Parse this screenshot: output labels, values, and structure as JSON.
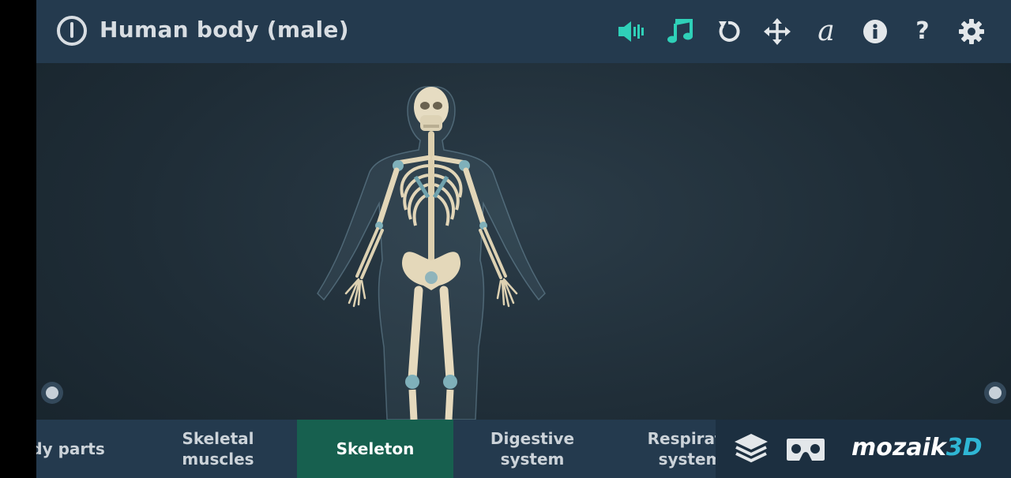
{
  "header": {
    "title": "Human body (male)"
  },
  "toolbar": {
    "icons": [
      "speaker-icon",
      "music-note-icon",
      "reset-rotation-icon",
      "move-icon",
      "text-label-icon",
      "info-icon",
      "help-icon",
      "settings-gear-icon"
    ]
  },
  "tabs": [
    {
      "label": "dy parts",
      "active": false
    },
    {
      "label": "Skeletal\nmuscles",
      "active": false
    },
    {
      "label": "Skeleton",
      "active": true
    },
    {
      "label": "Digestive\nsystem",
      "active": false
    },
    {
      "label": "Respirato\nsystem",
      "active": false
    }
  ],
  "logo": {
    "text": "mozaik",
    "accent": "3D"
  },
  "colors": {
    "topbar": "#243a4e",
    "active_tab": "#17604f",
    "accent_teal": "#2fd0b8",
    "logo_accent": "#2fb6d4"
  }
}
